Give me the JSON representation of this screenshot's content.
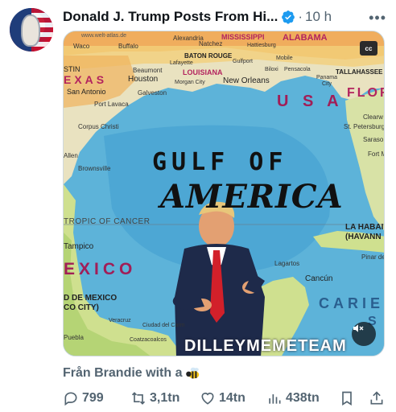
{
  "post": {
    "author": "Donald J. Trump Posts From Hi...",
    "separator": "·",
    "time": "10 h",
    "caption": "Från Brandie with a",
    "caption_emoji": "bee-icon"
  },
  "media": {
    "title_line1": "GULF OF",
    "title_line2": "AMERICA",
    "watermark": "DILLEYMEMETEAM",
    "cc_label": "cc",
    "country_usa": "U S A",
    "country_mexico": "EXICO",
    "caribe": "CARIE",
    "tropic": "TROPIC OF CANCER",
    "labels": {
      "waco": "Waco",
      "buffalo": "Buffalo",
      "alexandria": "Alexandria",
      "natchez": "Natchez",
      "mississippi": "MISSISSIPPI",
      "alabama": "ALABAMA",
      "hattiesburg": "Hattiesburg",
      "baton_rouge": "BATON ROUGE",
      "lafayette": "Lafayette",
      "gulfport": "Gulfport",
      "mobile": "Mobile",
      "beaumont": "Beaumont",
      "louisiana": "LOUISIANA",
      "houston": "Houston",
      "morgan_city": "Morgan City",
      "new_orleans": "New Orleans",
      "biloxi": "Biloxi",
      "pensacola": "Pensacola",
      "tallahassee": "TALLAHASSEE",
      "panama_city": "Panama City",
      "texas": "EXAS",
      "stin": "STIN",
      "san_antonio": "San Antonio",
      "galveston": "Galveston",
      "port_lavaca": "Port Lavaca",
      "flor": "FLOR",
      "clearwater": "Clearw",
      "st_petersburg": "St. Petersburg",
      "sarasota": "Saraso",
      "fort_m": "Fort M",
      "corpus": "Corpus Christi",
      "allen": "Allen",
      "brownsville": "Brownsville",
      "la_habana": "LA HABAI",
      "havana": "(HAVANN",
      "pinar": "Pinar del",
      "tampico": "Tampico",
      "lagartos": "Lagartos",
      "cancun": "Cancún",
      "df": "D DE MEXICO",
      "df2": "CO CITY)",
      "veracruz": "Veracruz",
      "ciudad_del_carmen": "Ciudad del Carm",
      "coatzacoalcos": "Coatzacoalcos",
      "puebla": "Puebla",
      "site": "www.welt-atlas.de",
      "st": "S E"
    }
  },
  "actions": {
    "replies": "799",
    "retweets": "3,1tn",
    "likes": "14tn",
    "views": "438tn"
  },
  "colors": {
    "text": "#0f1419",
    "muted": "#536471",
    "verified": "#1d9bf0",
    "water": "#5db3d9",
    "land": "#e9e2c0"
  }
}
